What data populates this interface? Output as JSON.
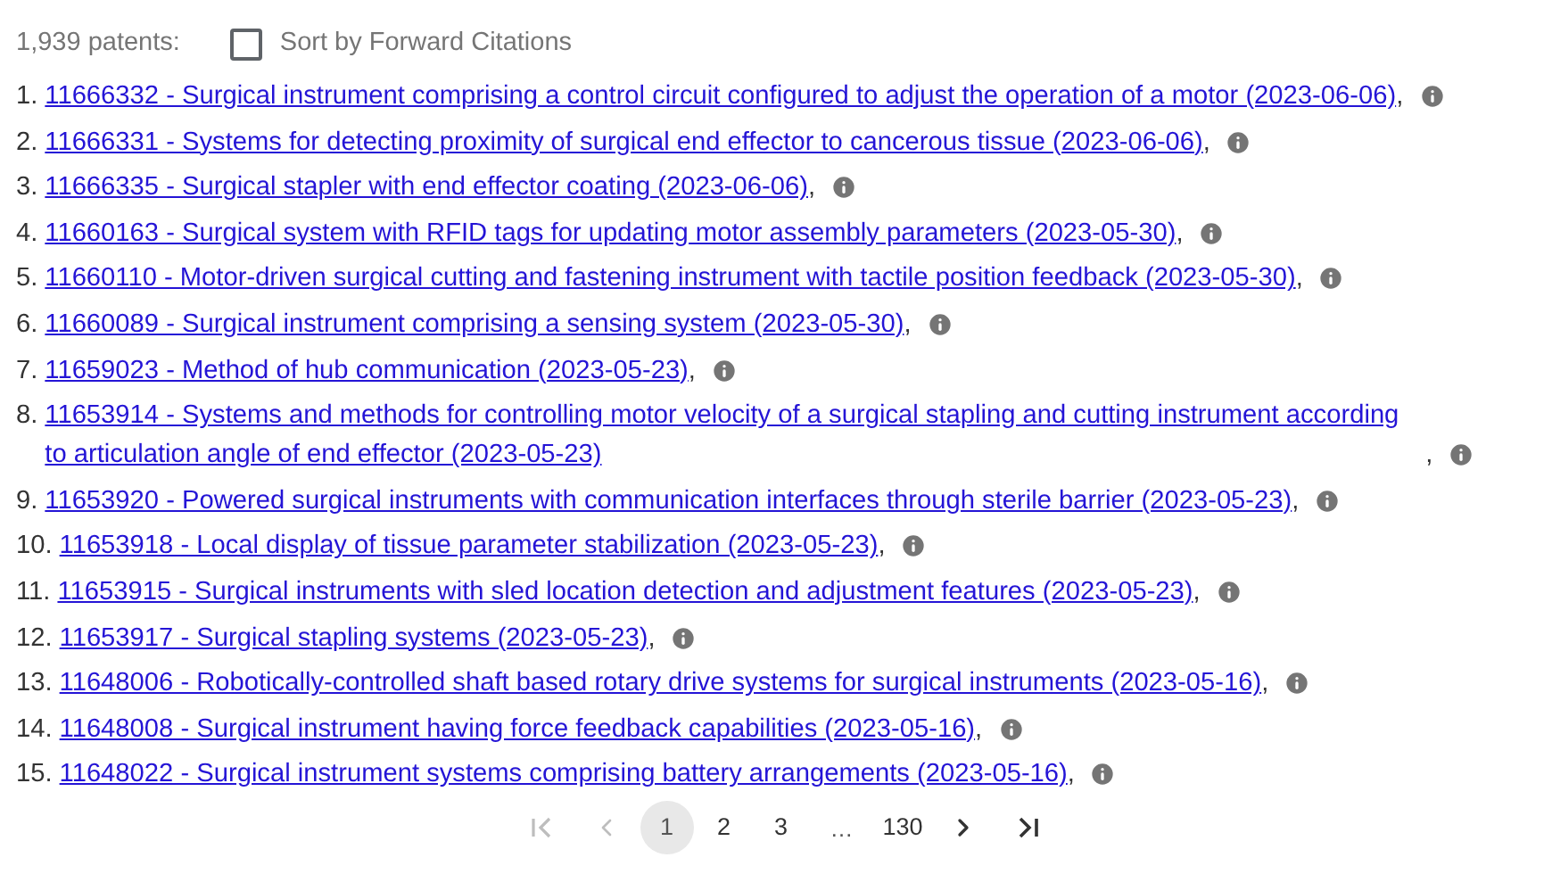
{
  "header": {
    "count": "1,939 patents:",
    "sort": {
      "label": "Sort by Forward Citations",
      "checked": false
    }
  },
  "patents": [
    {
      "number": "1.",
      "link": "11666332 - Surgical instrument comprising a control circuit configured to adjust the operation of a motor (2023-06-06)",
      "suffix": ","
    },
    {
      "number": "2.",
      "link": "11666331 - Systems for detecting proximity of surgical end effector to cancerous tissue (2023-06-06)",
      "suffix": ","
    },
    {
      "number": "3.",
      "link": "11666335 - Surgical stapler with end effector coating (2023-06-06)",
      "suffix": ","
    },
    {
      "number": "4.",
      "link": "11660163 - Surgical system with RFID tags for updating motor assembly parameters (2023-05-30)",
      "suffix": ","
    },
    {
      "number": "5.",
      "link": "11660110 - Motor-driven surgical cutting and fastening instrument with tactile position feedback (2023-05-30)",
      "suffix": ","
    },
    {
      "number": "6.",
      "link": "11660089 - Surgical instrument comprising a sensing system (2023-05-30)",
      "suffix": ","
    },
    {
      "number": "7.",
      "link": "11659023 - Method of hub communication (2023-05-23)",
      "suffix": ","
    },
    {
      "number": "8.",
      "link": "11653914 - Systems and methods for controlling motor velocity of a surgical stapling and cutting instrument according to articulation angle of end effector (2023-05-23)",
      "suffix": ","
    },
    {
      "number": "9.",
      "link": "11653920 - Powered surgical instruments with communication interfaces through sterile barrier (2023-05-23)",
      "suffix": ","
    },
    {
      "number": "10.",
      "link": "11653918 - Local display of tissue parameter stabilization (2023-05-23)",
      "suffix": ","
    },
    {
      "number": "11.",
      "link": "11653915 - Surgical instruments with sled location detection and adjustment features (2023-05-23)",
      "suffix": ","
    },
    {
      "number": "12.",
      "link": "11653917 - Surgical stapling systems (2023-05-23)",
      "suffix": ","
    },
    {
      "number": "13.",
      "link": "11648006 - Robotically-controlled shaft based rotary drive systems for surgical instruments (2023-05-16)",
      "suffix": ","
    },
    {
      "number": "14.",
      "link": "11648008 - Surgical instrument having force feedback capabilities (2023-05-16)",
      "suffix": ","
    },
    {
      "number": "15.",
      "link": "11648022 - Surgical instrument systems comprising battery arrangements (2023-05-16)",
      "suffix": ","
    }
  ],
  "pagination": [
    {
      "kind": "first",
      "disabled": true
    },
    {
      "kind": "prev",
      "disabled": true
    },
    {
      "kind": "page",
      "label": "1",
      "selected": true
    },
    {
      "kind": "page",
      "label": "2",
      "selected": false
    },
    {
      "kind": "page",
      "label": "3",
      "selected": false
    },
    {
      "kind": "ellipsis",
      "label": "…"
    },
    {
      "kind": "page",
      "label": "130",
      "selected": false
    },
    {
      "kind": "next",
      "disabled": false
    },
    {
      "kind": "last",
      "disabled": false
    }
  ]
}
